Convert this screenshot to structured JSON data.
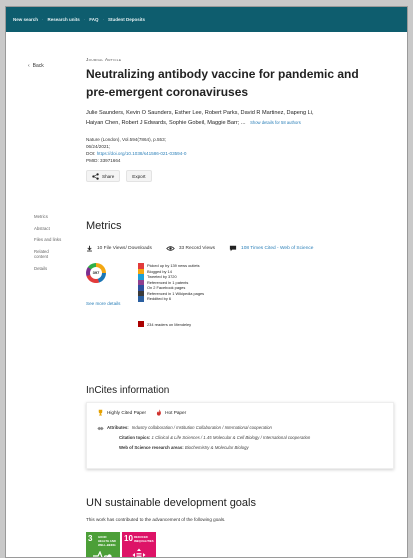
{
  "nav": {
    "items": [
      "New search",
      "Research units",
      "FAQ",
      "Student Deposits"
    ]
  },
  "back_label": "Back",
  "article": {
    "type": "Journal Article",
    "title_line1": "Neutralizing antibody vaccine for pandemic and",
    "title_line2": "pre-emergent coronaviruses",
    "authors_line1": "Julie Saunders, Kevin O Saunders, Esther Lee, Robert Parks, David R Martinez, Dapeng Li,",
    "authors_line2": "Haiyan Chen, Robert J Edwards, Sophie Gobeil, Maggie Barr; ...",
    "show_more": "Show details for 58 authors",
    "journal": "Nature (London), Vol.594(7864), p.553;",
    "date": "06/24/2021;",
    "doi_label": "DOI:",
    "doi": "https://doi.org/10.1038/s41586-021-03594-0",
    "pmid": "PMID: 33971664"
  },
  "actions": {
    "share": "Share",
    "export": "Export"
  },
  "sidenav": [
    "Metrics",
    "Abstract",
    "Files and links",
    "Related content",
    "Details"
  ],
  "metrics": {
    "title": "Metrics",
    "views": "10 File Views/ Downloads",
    "record_views": "33 Record Views",
    "wos": "108 Times Cited - Web of Science",
    "altmetric_score": "397",
    "see_more": "See more details",
    "altmetric_rows": [
      {
        "text": "Picked up by 139 news outlets",
        "color": "#e23b3b"
      },
      {
        "text": "Blogged by 14",
        "color": "#f3a712"
      },
      {
        "text": "Tweeted by 3720",
        "color": "#1c9fd8"
      },
      {
        "text": "Referenced in 1 patents",
        "color": "#8f3f8f"
      },
      {
        "text": "On 2 Facebook pages",
        "color": "#2d4f9e"
      },
      {
        "text": "Referenced in 1 Wikipedia pages",
        "color": "#3a3a3a"
      },
      {
        "text": "Reddited by 6",
        "color": "#2a5fa0"
      }
    ],
    "mendeley": "234 readers on Mendeley"
  },
  "incites": {
    "title": "InCites information",
    "highly_cited": "Highly Cited Paper",
    "hot_paper": "Hot Paper",
    "attributes_label": "Attributes:",
    "attributes_val": "Industry collaboration / Institution Collaboration / International cooperation",
    "citation_label": "Citation topics:",
    "citation_val": "1 Clinical & Life Sciences / 1.45 Molecular & Cell Biology / International cooperation",
    "wos_label": "Web of Science research areas:",
    "wos_val": "Biochemistry & Molecular Biology"
  },
  "un": {
    "title": "UN sustainable development goals",
    "subtitle": "This work has contributed to the advancement of the following goals.",
    "goals": [
      {
        "num": "3",
        "label": "GOOD HEALTH AND WELL-BEING",
        "color": "#4c9f38"
      },
      {
        "num": "10",
        "label": "REDUCED INEQUALITIES",
        "color": "#dd1367"
      }
    ]
  }
}
